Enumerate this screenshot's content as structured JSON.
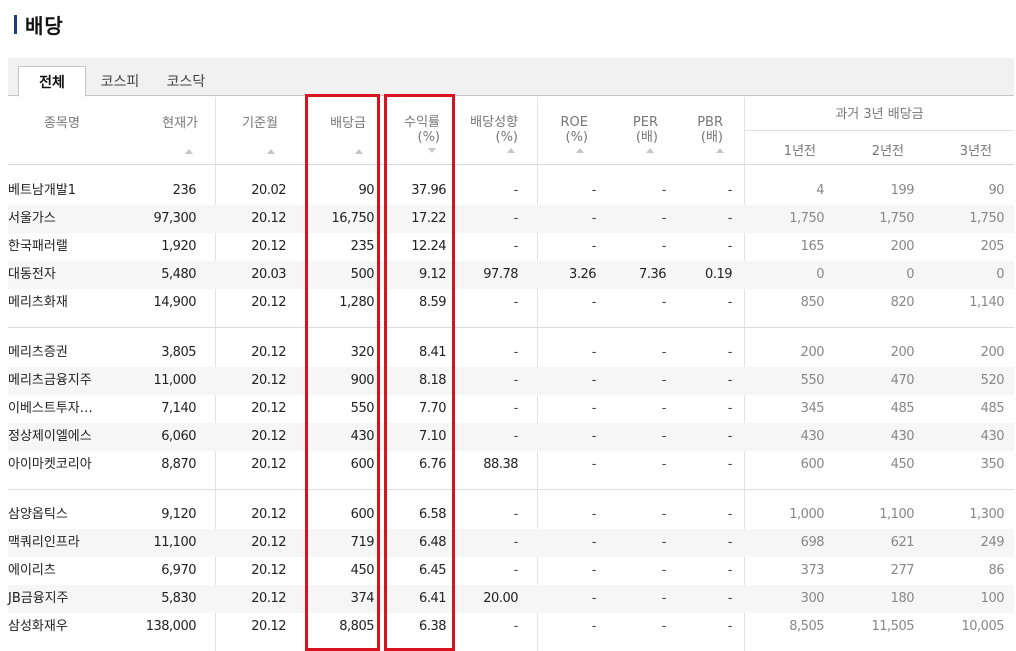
{
  "title": "배당",
  "tabs": [
    {
      "label": "전체",
      "active": true
    },
    {
      "label": "코스피",
      "active": false
    },
    {
      "label": "코스닥",
      "active": false
    }
  ],
  "headers": {
    "name": "종목명",
    "price": "현재가",
    "base_month": "기준월",
    "dividend": "배당금",
    "yield_line1": "수익률",
    "yield_line2": "(%)",
    "payout_line1": "배당성향",
    "payout_line2": "(%)",
    "roe_line1": "ROE",
    "roe_line2": "(%)",
    "per_line1": "PER",
    "per_line2": "(배)",
    "pbr_line1": "PBR",
    "pbr_line2": "(배)",
    "past_group": "과거 3년 배당금",
    "past1": "1년전",
    "past2": "2년전",
    "past3": "3년전"
  },
  "rows": [
    {
      "name": "베트남개발1",
      "price": "236",
      "month": "20.02",
      "div": "90",
      "yield": "37.96",
      "payout": "-",
      "roe": "-",
      "per": "-",
      "pbr": "-",
      "p1": "4",
      "p2": "199",
      "p3": "90"
    },
    {
      "name": "서울가스",
      "price": "97,300",
      "month": "20.12",
      "div": "16,750",
      "yield": "17.22",
      "payout": "-",
      "roe": "-",
      "per": "-",
      "pbr": "-",
      "p1": "1,750",
      "p2": "1,750",
      "p3": "1,750"
    },
    {
      "name": "한국패러랠",
      "price": "1,920",
      "month": "20.12",
      "div": "235",
      "yield": "12.24",
      "payout": "-",
      "roe": "-",
      "per": "-",
      "pbr": "-",
      "p1": "165",
      "p2": "200",
      "p3": "205"
    },
    {
      "name": "대동전자",
      "price": "5,480",
      "month": "20.03",
      "div": "500",
      "yield": "9.12",
      "payout": "97.78",
      "roe": "3.26",
      "per": "7.36",
      "pbr": "0.19",
      "p1": "0",
      "p2": "0",
      "p3": "0"
    },
    {
      "name": "메리츠화재",
      "price": "14,900",
      "month": "20.12",
      "div": "1,280",
      "yield": "8.59",
      "payout": "-",
      "roe": "-",
      "per": "-",
      "pbr": "-",
      "p1": "850",
      "p2": "820",
      "p3": "1,140"
    },
    {
      "name": "메리츠증권",
      "price": "3,805",
      "month": "20.12",
      "div": "320",
      "yield": "8.41",
      "payout": "-",
      "roe": "-",
      "per": "-",
      "pbr": "-",
      "p1": "200",
      "p2": "200",
      "p3": "200"
    },
    {
      "name": "메리츠금융지주",
      "price": "11,000",
      "month": "20.12",
      "div": "900",
      "yield": "8.18",
      "payout": "-",
      "roe": "-",
      "per": "-",
      "pbr": "-",
      "p1": "550",
      "p2": "470",
      "p3": "520"
    },
    {
      "name": "이베스트투자…",
      "price": "7,140",
      "month": "20.12",
      "div": "550",
      "yield": "7.70",
      "payout": "-",
      "roe": "-",
      "per": "-",
      "pbr": "-",
      "p1": "345",
      "p2": "485",
      "p3": "485"
    },
    {
      "name": "정상제이엘에스",
      "price": "6,060",
      "month": "20.12",
      "div": "430",
      "yield": "7.10",
      "payout": "-",
      "roe": "-",
      "per": "-",
      "pbr": "-",
      "p1": "430",
      "p2": "430",
      "p3": "430"
    },
    {
      "name": "아이마켓코리아",
      "price": "8,870",
      "month": "20.12",
      "div": "600",
      "yield": "6.76",
      "payout": "88.38",
      "roe": "-",
      "per": "-",
      "pbr": "-",
      "p1": "600",
      "p2": "450",
      "p3": "350"
    },
    {
      "name": "삼양옵틱스",
      "price": "9,120",
      "month": "20.12",
      "div": "600",
      "yield": "6.58",
      "payout": "-",
      "roe": "-",
      "per": "-",
      "pbr": "-",
      "p1": "1,000",
      "p2": "1,100",
      "p3": "1,300"
    },
    {
      "name": "맥쿼리인프라",
      "price": "11,100",
      "month": "20.12",
      "div": "719",
      "yield": "6.48",
      "payout": "-",
      "roe": "-",
      "per": "-",
      "pbr": "-",
      "p1": "698",
      "p2": "621",
      "p3": "249"
    },
    {
      "name": "에이리츠",
      "price": "6,970",
      "month": "20.12",
      "div": "450",
      "yield": "6.45",
      "payout": "-",
      "roe": "-",
      "per": "-",
      "pbr": "-",
      "p1": "373",
      "p2": "277",
      "p3": "86"
    },
    {
      "name": "JB금융지주",
      "price": "5,830",
      "month": "20.12",
      "div": "374",
      "yield": "6.41",
      "payout": "20.00",
      "roe": "-",
      "per": "-",
      "pbr": "-",
      "p1": "300",
      "p2": "180",
      "p3": "100"
    },
    {
      "name": "삼성화재우",
      "price": "138,000",
      "month": "20.12",
      "div": "8,805",
      "yield": "6.38",
      "payout": "-",
      "roe": "-",
      "per": "-",
      "pbr": "-",
      "p1": "8,505",
      "p2": "11,505",
      "p3": "10,005"
    }
  ]
}
